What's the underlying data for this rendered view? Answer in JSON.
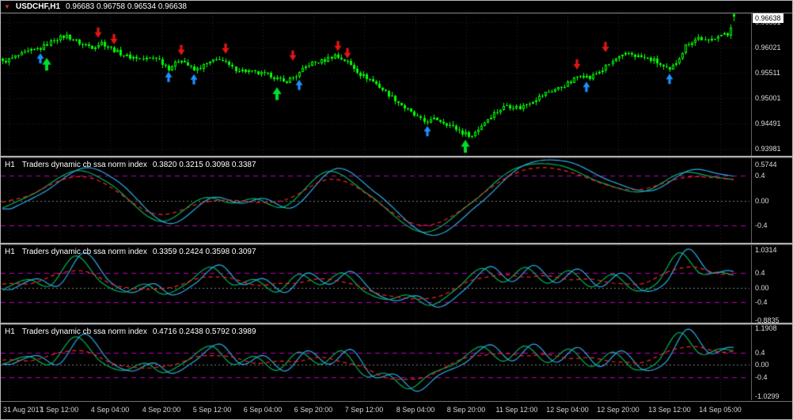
{
  "window": {
    "title": {
      "symbol": "USDCHF,H1",
      "ohlc": "0.96683 0.96758 0.96534 0.96638"
    }
  },
  "colors": {
    "background": "#000000",
    "frame": "#b8b8b8",
    "grid": "#262626",
    "candle": "#00FF00",
    "separator": "#909090",
    "axis_text": "#dedede",
    "level_magenta": "#B800B8",
    "level_zero": "#7a7a7a",
    "line_green": "#00B25A",
    "line_blue": "#2FA8E8",
    "line_red": "#FF2222",
    "arrow_red": "#E51414",
    "arrow_blue": "#1E90FF",
    "arrow_green": "#00DD2A",
    "price_tag_bg": "#FFFFFF",
    "price_tag_text": "#000000"
  },
  "time_axis": {
    "labels": [
      "31 Aug 2017",
      "1 Sep 12:00",
      "4 Sep 04:00",
      "4 Sep 20:00",
      "5 Sep 12:00",
      "6 Sep 04:00",
      "6 Sep 20:00",
      "7 Sep 12:00",
      "8 Sep 04:00",
      "8 Sep 20:00",
      "11 Sep 12:00",
      "12 Sep 04:00",
      "12 Sep 20:00",
      "13 Sep 12:00",
      "14 Sep 05:00"
    ]
  },
  "chart_data": [
    {
      "type": "candlestick",
      "panel": "main",
      "symbol": "USDCHF",
      "timeframe": "H1",
      "current_bar": {
        "open": 0.96683,
        "high": 0.96758,
        "low": 0.96534,
        "close": 0.96638
      },
      "last_price": "0.96638",
      "axis_labels": [
        "0.96531",
        "0.96021",
        "0.95511",
        "0.95001",
        "0.94491",
        "0.93981"
      ],
      "ylim": [
        0.9384,
        0.967
      ],
      "bars_total": 235,
      "bars_drawn": 230,
      "close_path": [
        [
          0,
          0.9572
        ],
        [
          6,
          0.9588
        ],
        [
          12,
          0.96
        ],
        [
          16,
          0.9618
        ],
        [
          20,
          0.9625
        ],
        [
          24,
          0.961
        ],
        [
          28,
          0.9603
        ],
        [
          31,
          0.9612
        ],
        [
          34,
          0.96
        ],
        [
          38,
          0.9586
        ],
        [
          44,
          0.9578
        ],
        [
          48,
          0.9582
        ],
        [
          52,
          0.956
        ],
        [
          56,
          0.9578
        ],
        [
          60,
          0.9555
        ],
        [
          64,
          0.9568
        ],
        [
          68,
          0.958
        ],
        [
          72,
          0.956
        ],
        [
          78,
          0.9552
        ],
        [
          84,
          0.9545
        ],
        [
          88,
          0.9532
        ],
        [
          92,
          0.9545
        ],
        [
          96,
          0.9568
        ],
        [
          100,
          0.9574
        ],
        [
          104,
          0.9586
        ],
        [
          108,
          0.9572
        ],
        [
          112,
          0.9548
        ],
        [
          116,
          0.9534
        ],
        [
          120,
          0.9512
        ],
        [
          124,
          0.9492
        ],
        [
          128,
          0.947
        ],
        [
          132,
          0.9452
        ],
        [
          136,
          0.9458
        ],
        [
          140,
          0.9446
        ],
        [
          144,
          0.943
        ],
        [
          147,
          0.9424
        ],
        [
          150,
          0.9446
        ],
        [
          154,
          0.947
        ],
        [
          158,
          0.9486
        ],
        [
          162,
          0.948
        ],
        [
          166,
          0.9496
        ],
        [
          170,
          0.951
        ],
        [
          174,
          0.952
        ],
        [
          178,
          0.9532
        ],
        [
          181,
          0.9548
        ],
        [
          184,
          0.954
        ],
        [
          188,
          0.9558
        ],
        [
          192,
          0.9578
        ],
        [
          196,
          0.959
        ],
        [
          200,
          0.9582
        ],
        [
          204,
          0.9575
        ],
        [
          207,
          0.9562
        ],
        [
          209,
          0.9555
        ],
        [
          211,
          0.9572
        ],
        [
          214,
          0.9605
        ],
        [
          218,
          0.9622
        ],
        [
          221,
          0.9612
        ],
        [
          224,
          0.9628
        ],
        [
          227,
          0.9626
        ],
        [
          229,
          0.96638
        ]
      ],
      "markers": [
        {
          "bar": 12,
          "price": 0.959,
          "dir": "up",
          "color": "blue"
        },
        {
          "bar": 14,
          "price": 0.9581,
          "dir": "up",
          "color": "green"
        },
        {
          "bar": 30,
          "price": 0.9621,
          "dir": "down",
          "color": "red"
        },
        {
          "bar": 35,
          "price": 0.9608,
          "dir": "down",
          "color": "red"
        },
        {
          "bar": 52,
          "price": 0.9553,
          "dir": "up",
          "color": "blue"
        },
        {
          "bar": 56,
          "price": 0.9586,
          "dir": "down",
          "color": "red"
        },
        {
          "bar": 60,
          "price": 0.9548,
          "dir": "up",
          "color": "blue"
        },
        {
          "bar": 70,
          "price": 0.9589,
          "dir": "down",
          "color": "red"
        },
        {
          "bar": 86,
          "price": 0.9522,
          "dir": "up",
          "color": "green"
        },
        {
          "bar": 91,
          "price": 0.9575,
          "dir": "down",
          "color": "red"
        },
        {
          "bar": 93,
          "price": 0.9537,
          "dir": "up",
          "color": "blue"
        },
        {
          "bar": 105,
          "price": 0.9594,
          "dir": "down",
          "color": "red"
        },
        {
          "bar": 108,
          "price": 0.958,
          "dir": "down",
          "color": "red"
        },
        {
          "bar": 133,
          "price": 0.9444,
          "dir": "up",
          "color": "blue"
        },
        {
          "bar": 145,
          "price": 0.9416,
          "dir": "up",
          "color": "green"
        },
        {
          "bar": 180,
          "price": 0.9557,
          "dir": "down",
          "color": "red"
        },
        {
          "bar": 183,
          "price": 0.9533,
          "dir": "up",
          "color": "blue"
        },
        {
          "bar": 189,
          "price": 0.9592,
          "dir": "down",
          "color": "red"
        },
        {
          "bar": 209,
          "price": 0.9549,
          "dir": "up",
          "color": "blue"
        }
      ]
    },
    {
      "type": "line",
      "panel": "indicator-1",
      "timeframe": "H1",
      "title": "Traders dynamic cb ssa norm index",
      "values_text": "0.3820 0.3215 0.3098 0.3387",
      "values": [
        0.382,
        0.3215,
        0.3098,
        0.3387
      ],
      "axis_labels": [
        "0.5744",
        "0.4",
        "0.00",
        "-0.4"
      ],
      "ylim": [
        -0.67,
        0.67
      ],
      "levels": {
        "magenta": [
          0.4,
          -0.4
        ],
        "zero": 0
      },
      "series_anchors": [
        [
          0.0,
          -0.12
        ],
        [
          0.045,
          0.12
        ],
        [
          0.1,
          0.47
        ],
        [
          0.145,
          0.28
        ],
        [
          0.215,
          -0.33
        ],
        [
          0.275,
          0.04
        ],
        [
          0.315,
          -0.04
        ],
        [
          0.345,
          0.03
        ],
        [
          0.385,
          -0.1
        ],
        [
          0.445,
          0.46
        ],
        [
          0.5,
          0.1
        ],
        [
          0.575,
          -0.5
        ],
        [
          0.64,
          -0.05
        ],
        [
          0.7,
          0.5
        ],
        [
          0.76,
          0.56
        ],
        [
          0.82,
          0.28
        ],
        [
          0.875,
          0.14
        ],
        [
          0.93,
          0.44
        ],
        [
          0.97,
          0.38
        ],
        [
          1.0,
          0.33
        ]
      ]
    },
    {
      "type": "line",
      "panel": "indicator-2",
      "timeframe": "H1",
      "title": "Traders dynamic cb ssa norm index",
      "values_text": "0.3359 0.2424 0.3598 0.3097",
      "values": [
        0.3359,
        0.2424,
        0.3598,
        0.3097
      ],
      "axis_labels": [
        "1.0314",
        "0.4",
        "0.00",
        "-0.4",
        "-0.8835"
      ],
      "ylim": [
        -0.95,
        1.15
      ],
      "levels": {
        "magenta": [
          0.4,
          -0.4
        ],
        "zero": 0
      },
      "series_anchors": [
        [
          0.0,
          -0.05
        ],
        [
          0.035,
          0.22
        ],
        [
          0.065,
          0.05
        ],
        [
          0.1,
          0.86
        ],
        [
          0.135,
          0.15
        ],
        [
          0.165,
          -0.12
        ],
        [
          0.195,
          0.1
        ],
        [
          0.22,
          -0.18
        ],
        [
          0.25,
          0.08
        ],
        [
          0.285,
          0.56
        ],
        [
          0.315,
          0.08
        ],
        [
          0.345,
          0.22
        ],
        [
          0.375,
          -0.12
        ],
        [
          0.405,
          0.36
        ],
        [
          0.435,
          0.08
        ],
        [
          0.465,
          0.4
        ],
        [
          0.495,
          -0.1
        ],
        [
          0.525,
          -0.32
        ],
        [
          0.555,
          -0.2
        ],
        [
          0.585,
          -0.48
        ],
        [
          0.62,
          -0.05
        ],
        [
          0.655,
          0.52
        ],
        [
          0.685,
          0.15
        ],
        [
          0.715,
          0.55
        ],
        [
          0.745,
          0.12
        ],
        [
          0.775,
          0.46
        ],
        [
          0.805,
          0.02
        ],
        [
          0.835,
          0.36
        ],
        [
          0.865,
          -0.08
        ],
        [
          0.895,
          0.12
        ],
        [
          0.925,
          0.95
        ],
        [
          0.955,
          0.38
        ],
        [
          0.98,
          0.42
        ],
        [
          1.0,
          0.34
        ]
      ]
    },
    {
      "type": "line",
      "panel": "indicator-3",
      "timeframe": "H1",
      "title": "Traders dynamic cb ssa norm index",
      "values_text": "0.4716 0.2438 0.5792 0.3989",
      "values": [
        0.4716,
        0.2438,
        0.5792,
        0.3989
      ],
      "axis_labels": [
        "1.1908",
        "0.4",
        "0.00",
        "-0.4",
        "-1.0299"
      ],
      "ylim": [
        -1.15,
        1.3
      ],
      "levels": {
        "magenta": [
          0.4,
          -0.4
        ],
        "zero": 0
      },
      "series_anchors": [
        [
          0.0,
          0.02
        ],
        [
          0.035,
          0.28
        ],
        [
          0.065,
          0.02
        ],
        [
          0.1,
          0.92
        ],
        [
          0.135,
          0.1
        ],
        [
          0.165,
          -0.18
        ],
        [
          0.195,
          0.06
        ],
        [
          0.22,
          -0.25
        ],
        [
          0.25,
          0.1
        ],
        [
          0.285,
          0.62
        ],
        [
          0.315,
          0.02
        ],
        [
          0.345,
          0.28
        ],
        [
          0.375,
          -0.18
        ],
        [
          0.405,
          0.42
        ],
        [
          0.435,
          0.02
        ],
        [
          0.465,
          0.46
        ],
        [
          0.495,
          -0.35
        ],
        [
          0.525,
          -0.28
        ],
        [
          0.555,
          -0.78
        ],
        [
          0.585,
          -0.3
        ],
        [
          0.62,
          0.05
        ],
        [
          0.655,
          0.6
        ],
        [
          0.685,
          0.12
        ],
        [
          0.715,
          0.62
        ],
        [
          0.745,
          0.08
        ],
        [
          0.775,
          0.52
        ],
        [
          0.805,
          -0.05
        ],
        [
          0.835,
          0.42
        ],
        [
          0.865,
          -0.15
        ],
        [
          0.895,
          0.08
        ],
        [
          0.925,
          1.06
        ],
        [
          0.955,
          0.35
        ],
        [
          0.98,
          0.52
        ],
        [
          1.0,
          0.47
        ]
      ]
    }
  ]
}
